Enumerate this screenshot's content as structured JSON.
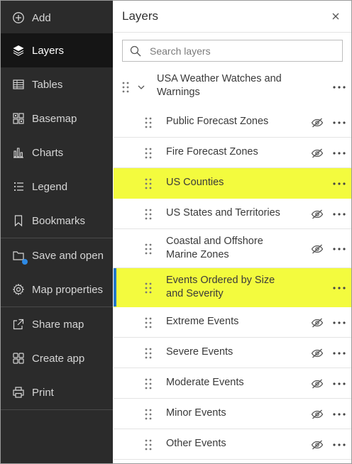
{
  "sidebar": {
    "items": [
      {
        "name": "sidebar-item-add",
        "label": "Add",
        "icon": "plus-circle-icon"
      },
      {
        "name": "sidebar-item-layers",
        "label": "Layers",
        "icon": "layers-icon",
        "active": true
      },
      {
        "name": "sidebar-item-tables",
        "label": "Tables",
        "icon": "table-icon"
      },
      {
        "name": "sidebar-item-basemap",
        "label": "Basemap",
        "icon": "basemap-grid-icon"
      },
      {
        "name": "sidebar-item-charts",
        "label": "Charts",
        "icon": "bar-chart-icon"
      },
      {
        "name": "sidebar-item-legend",
        "label": "Legend",
        "icon": "legend-list-icon"
      },
      {
        "name": "sidebar-item-bookmarks",
        "label": "Bookmarks",
        "icon": "bookmark-icon"
      },
      {
        "name": "sidebar-item-save-and-open",
        "label": "Save and open",
        "icon": "folder-icon"
      },
      {
        "name": "sidebar-item-map-properties",
        "label": "Map properties",
        "icon": "gear-icon"
      },
      {
        "name": "sidebar-item-share-map",
        "label": "Share map",
        "icon": "share-icon"
      },
      {
        "name": "sidebar-item-create-app",
        "label": "Create app",
        "icon": "apps-grid-icon"
      },
      {
        "name": "sidebar-item-print",
        "label": "Print",
        "icon": "printer-icon"
      }
    ]
  },
  "panel": {
    "title": "Layers",
    "search_placeholder": "Search layers",
    "group": {
      "label": "USA Weather Watches and Warnings"
    },
    "layers": [
      {
        "label": "Public Forecast Zones",
        "hidden": true
      },
      {
        "label": "Fire Forecast Zones",
        "hidden": true
      },
      {
        "label": "US Counties",
        "hidden": false
      },
      {
        "label": "US States and Territories",
        "hidden": true
      },
      {
        "label": "Coastal and Offshore Marine Zones",
        "hidden": true
      },
      {
        "label": "Events Ordered by Size and Severity",
        "hidden": false
      },
      {
        "label": "Extreme Events",
        "hidden": true
      },
      {
        "label": "Severe Events",
        "hidden": true
      },
      {
        "label": "Moderate Events",
        "hidden": true
      },
      {
        "label": "Minor Events",
        "hidden": true
      },
      {
        "label": "Other Events",
        "hidden": true
      }
    ]
  },
  "colors": {
    "sidebar_bg": "#2b2b2b",
    "sidebar_active_bg": "#151515",
    "highlight": "#f3fb3e",
    "selection_bar": "#2477c7",
    "badge": "#2d8ae6"
  }
}
